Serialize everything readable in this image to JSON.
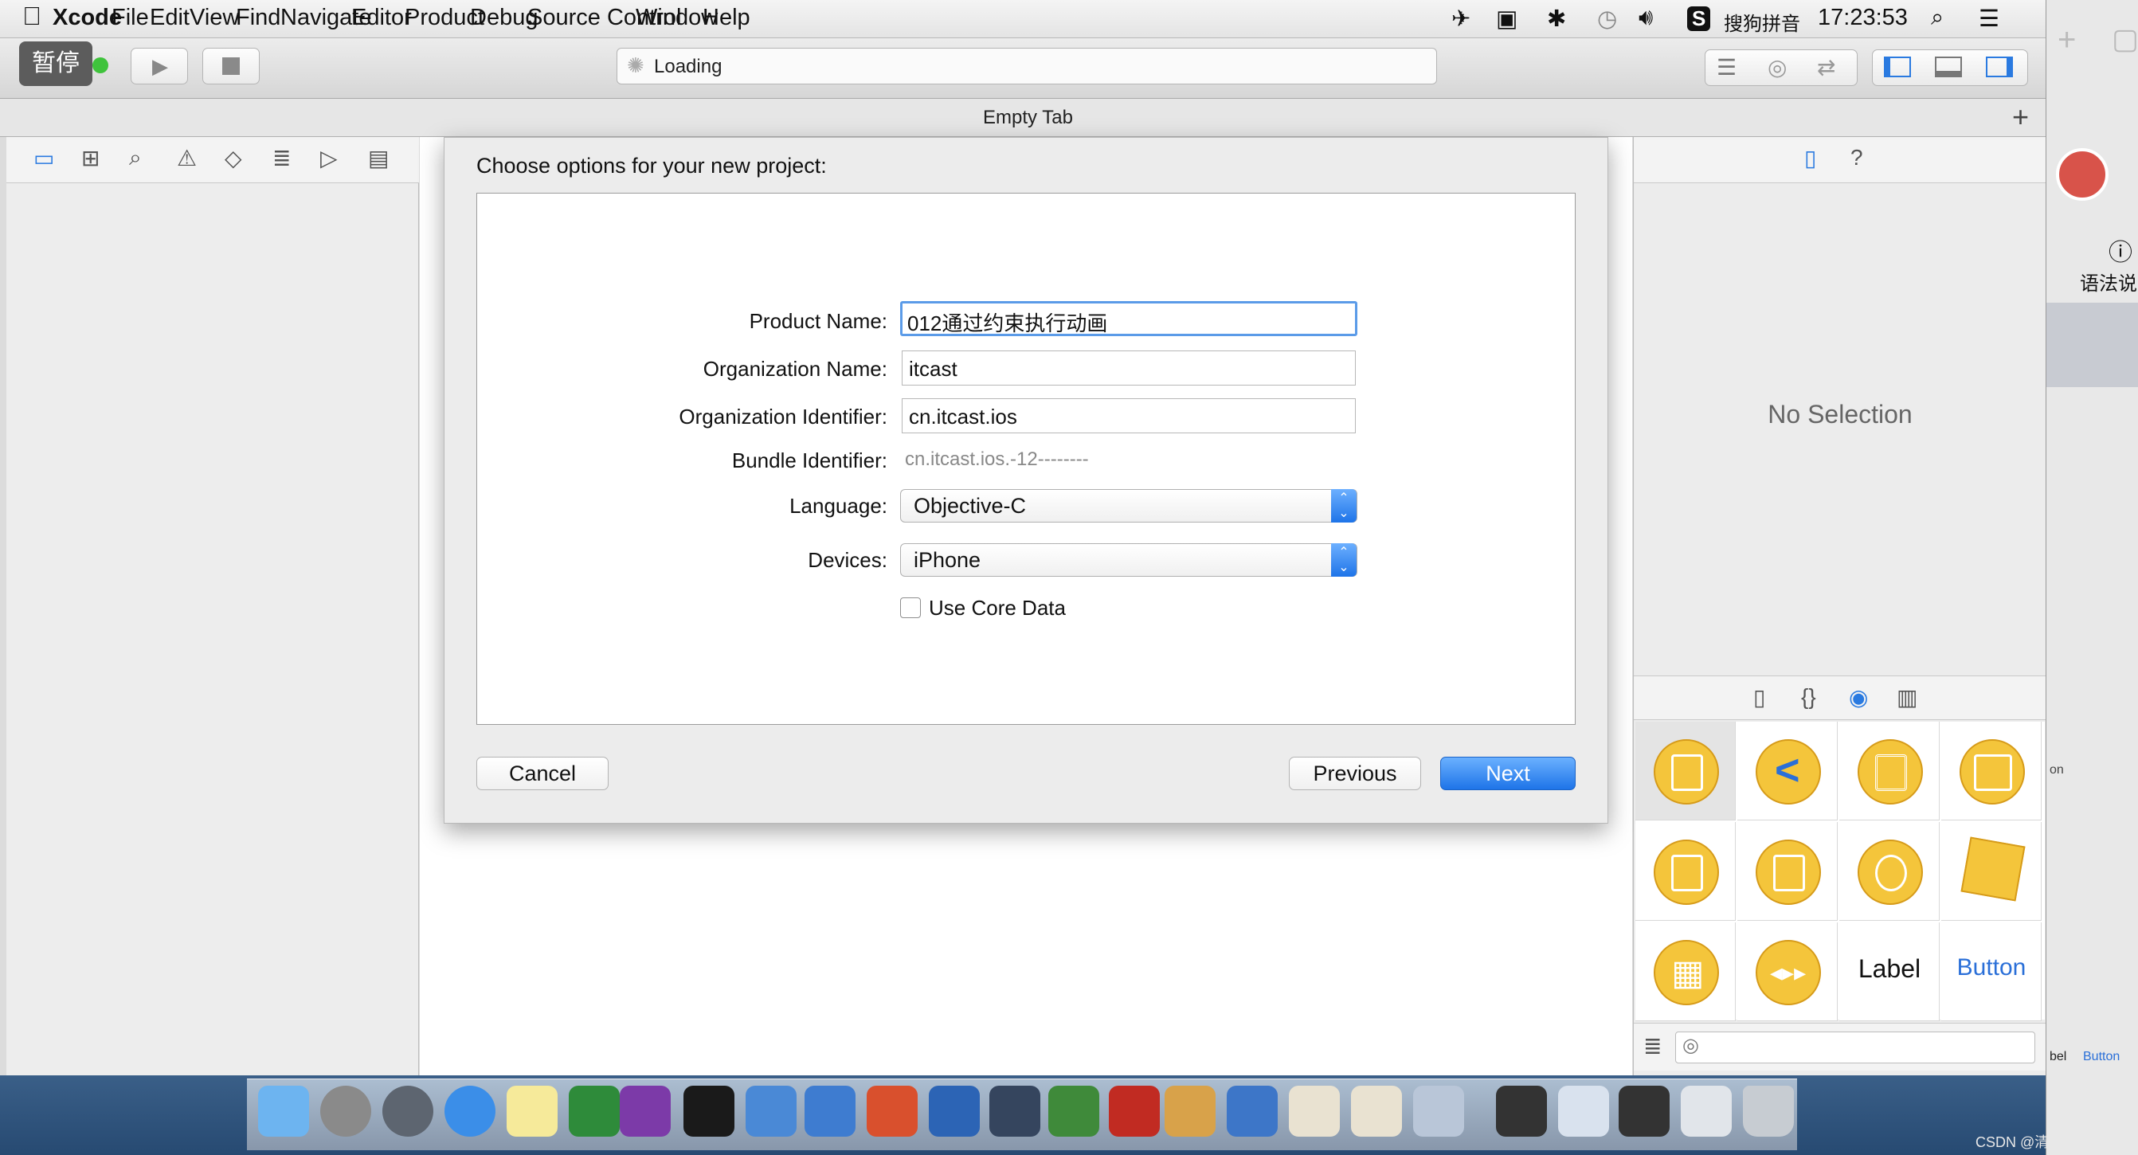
{
  "menubar": {
    "app": "Xcode",
    "items": [
      "File",
      "Edit",
      "View",
      "Find",
      "Navigate",
      "Editor",
      "Product",
      "Debug",
      "Source Control",
      "Window",
      "Help"
    ],
    "input_method": "搜狗拼音",
    "clock": "17:23:53"
  },
  "toolbar": {
    "pause_label": "暂停",
    "status_text": "Loading"
  },
  "tab": {
    "title": "Empty Tab"
  },
  "dialog": {
    "title": "Choose options for your new project:",
    "product_name_label": "Product Name:",
    "product_name_value": "012通过约束执行动画",
    "org_name_label": "Organization Name:",
    "org_name_value": "itcast",
    "org_id_label": "Organization Identifier:",
    "org_id_value": "cn.itcast.ios",
    "bundle_id_label": "Bundle Identifier:",
    "bundle_id_value": "cn.itcast.ios.-12--------",
    "language_label": "Language:",
    "language_value": "Objective-C",
    "devices_label": "Devices:",
    "devices_value": "iPhone",
    "core_data_label": "Use Core Data",
    "cancel": "Cancel",
    "previous": "Previous",
    "next": "Next"
  },
  "inspector": {
    "no_selection": "No Selection",
    "library_cells": [
      "Label",
      "Button"
    ]
  },
  "right_panel": {
    "text": "语法说",
    "mini_labels": [
      "bel",
      "Button",
      "on"
    ]
  },
  "watermark": "CSDN @清风清风",
  "colors": {
    "accent": "#1e74e8",
    "gold": "#f4c53b"
  }
}
